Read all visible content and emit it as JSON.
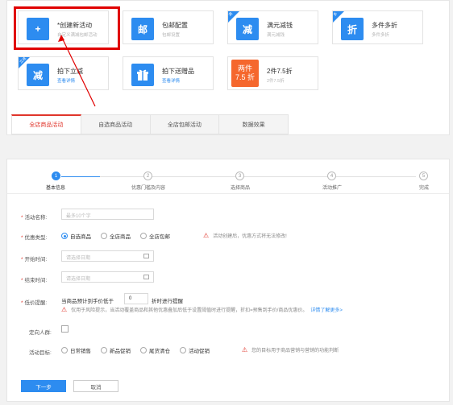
{
  "cards": [
    {
      "title": "*创建新活动",
      "sub": "自定义满减包邮活动",
      "icon": "+",
      "color": "#2d8cf0",
      "corner": ""
    },
    {
      "title": "包邮配置",
      "sub": "包邮设置",
      "icon": "邮",
      "color": "#2d8cf0",
      "corner": ""
    },
    {
      "title": "满元减钱",
      "sub": "满元减钱",
      "icon": "减",
      "color": "#2d8cf0",
      "corner": "满"
    },
    {
      "title": "多件多折",
      "sub": "多件多折",
      "icon": "折",
      "color": "#2d8cf0",
      "corner": "多"
    },
    {
      "title": "拍下立减",
      "sub": "查看详情",
      "icon": "减",
      "color": "#2d8cf0",
      "corner": "立减"
    },
    {
      "title": "拍下送赠品",
      "sub": "查看详情",
      "icon": "🎁",
      "color": "#2d8cf0",
      "corner": ""
    },
    {
      "title": "2件7.5折",
      "sub": "2件7.5折",
      "icon_line1": "两件",
      "icon_line2": "7.5 折",
      "color": "#f5672d",
      "corner": ""
    }
  ],
  "tabs": [
    "全店商品活动",
    "自选商品活动",
    "全店包邮活动",
    "数据效果"
  ],
  "steps": [
    "基本信息",
    "优惠门槛及内容",
    "选择商品",
    "活动推广",
    "完成"
  ],
  "form": {
    "name_label": "活动名称:",
    "name_placeholder": "最多10个字",
    "type_label": "优惠类型:",
    "type_options": [
      "自选商品",
      "全店商品",
      "全店包邮"
    ],
    "type_warning": "活动创建后，优惠方式将无法修改!",
    "start_label": "开始时间:",
    "end_label": "结束时间:",
    "date_placeholder": "请选择日期",
    "price_label": "低价提醒:",
    "price_text_pre": "当商品预计到手价低于",
    "price_value": "0",
    "price_text_post": "折时进行提醒",
    "price_warning": "仅用于风险提示，当活动覆盖商品和其他优惠叠加后低于设置阈值时进行提醒，折扣=预售到手价/商品优惠价。",
    "price_link": "详情了解更多>",
    "crowd_label": "定向人群:",
    "goal_label": "活动目标:",
    "goal_options": [
      "日常销售",
      "新品促销",
      "尾货清仓",
      "活动促销"
    ],
    "goal_warning": "您的目标用于商品营销与营销的功能判断",
    "next_label": "下一步",
    "cancel_label": "取消"
  }
}
